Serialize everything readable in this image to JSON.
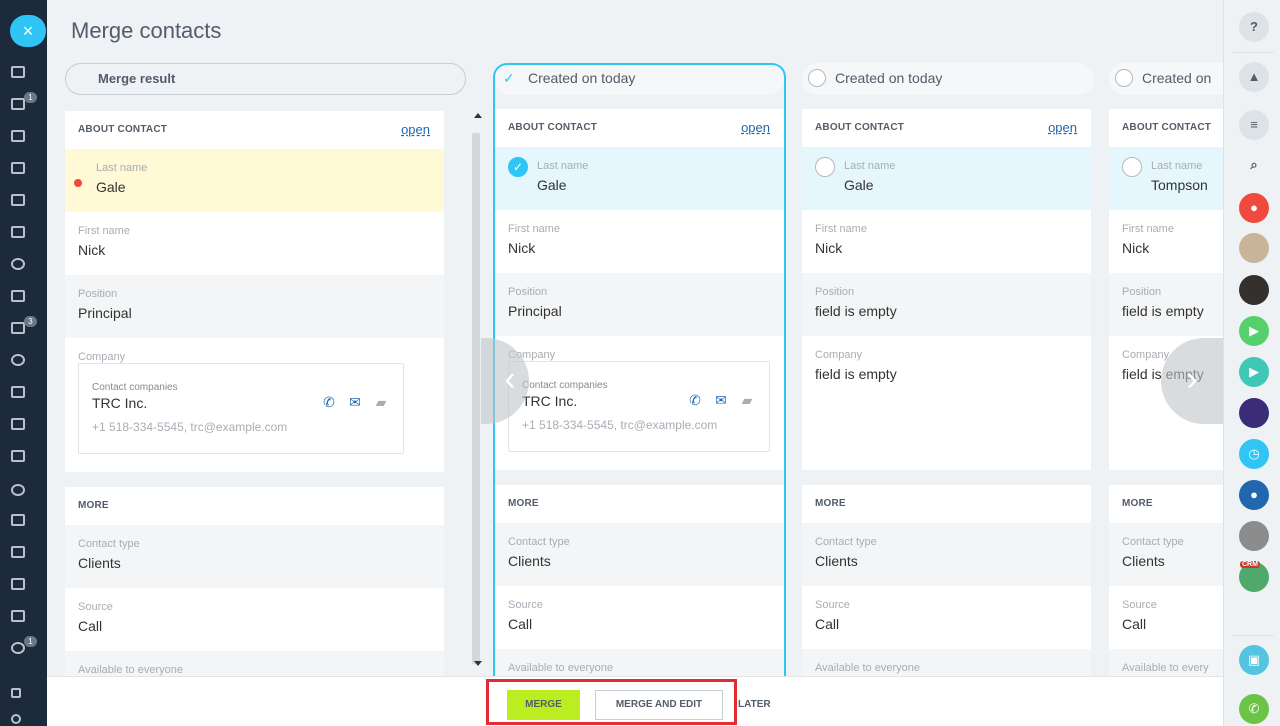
{
  "page": {
    "title": "Merge contacts"
  },
  "left_sidebar": {
    "close_label": "×",
    "badges": [
      "1",
      "3",
      "1"
    ]
  },
  "columns": [
    {
      "header": "Merge result",
      "about": {
        "title": "ABOUT CONTACT",
        "open": "open",
        "fields": [
          {
            "label": "Last name",
            "value": "Gale"
          },
          {
            "label": "First name",
            "value": "Nick"
          },
          {
            "label": "Position",
            "value": "Principal"
          },
          {
            "label": "Company",
            "value": ""
          }
        ],
        "company": {
          "label": "Contact companies",
          "name": "TRC Inc.",
          "info": "+1 518-334-5545, trc@example.com"
        }
      },
      "more": {
        "title": "MORE",
        "fields": [
          {
            "label": "Contact type",
            "value": "Clients"
          },
          {
            "label": "Source",
            "value": "Call"
          },
          {
            "label": "Available to everyone",
            "value": ""
          }
        ]
      }
    },
    {
      "header": "Created on today",
      "about": {
        "title": "ABOUT CONTACT",
        "open": "open",
        "fields": [
          {
            "label": "Last name",
            "value": "Gale"
          },
          {
            "label": "First name",
            "value": "Nick"
          },
          {
            "label": "Position",
            "value": "Principal"
          },
          {
            "label": "Company",
            "value": ""
          }
        ],
        "company": {
          "label": "Contact companies",
          "name": "TRC Inc.",
          "info": "+1 518-334-5545, trc@example.com"
        }
      },
      "more": {
        "title": "MORE",
        "fields": [
          {
            "label": "Contact type",
            "value": "Clients"
          },
          {
            "label": "Source",
            "value": "Call"
          },
          {
            "label": "Available to everyone",
            "value": ""
          }
        ]
      }
    },
    {
      "header": "Created on today",
      "about": {
        "title": "ABOUT CONTACT",
        "open": "open",
        "fields": [
          {
            "label": "Last name",
            "value": "Gale"
          },
          {
            "label": "First name",
            "value": "Nick"
          },
          {
            "label": "Position",
            "value": "field is empty"
          },
          {
            "label": "Company",
            "value": "field is empty"
          }
        ]
      },
      "more": {
        "title": "MORE",
        "fields": [
          {
            "label": "Contact type",
            "value": "Clients"
          },
          {
            "label": "Source",
            "value": "Call"
          },
          {
            "label": "Available to everyone",
            "value": ""
          }
        ]
      }
    },
    {
      "header": "Created on",
      "about": {
        "title": "ABOUT CONTACT",
        "fields": [
          {
            "label": "Last name",
            "value": "Tompson"
          },
          {
            "label": "First name",
            "value": "Nick"
          },
          {
            "label": "Position",
            "value": "field is empty"
          },
          {
            "label": "Company",
            "value": "field is empty"
          }
        ]
      },
      "more": {
        "title": "MORE",
        "fields": [
          {
            "label": "Contact type",
            "value": "Clients"
          },
          {
            "label": "Source",
            "value": "Call"
          },
          {
            "label": "Available to every",
            "value": ""
          }
        ]
      }
    }
  ],
  "bottom_bar": {
    "merge": "MERGE",
    "merge_and_edit": "MERGE AND EDIT",
    "later": "LATER"
  },
  "right_sidebar": {
    "help": "?",
    "crm_badge": "CRM"
  },
  "colors": {
    "accent": "#2fc6f6",
    "merge_button": "#bbed21",
    "highlight_frame": "#e32d36",
    "conflict_dot": "#f4473a"
  }
}
